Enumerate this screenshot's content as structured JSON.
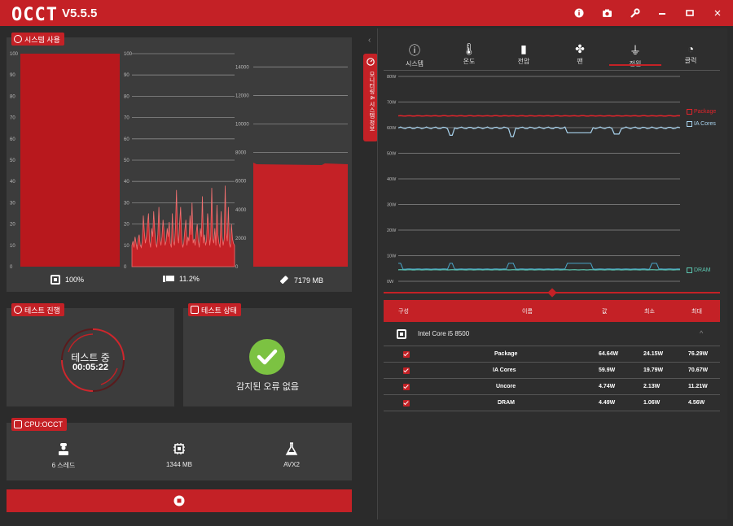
{
  "app": {
    "logo": "OCCT",
    "version": "V5.5.5"
  },
  "titlebar_icons": [
    "info-icon",
    "camera-icon",
    "wrench-icon",
    "minimize-icon",
    "maximize-icon",
    "close-icon"
  ],
  "system_usage": {
    "title": "시스템 사용",
    "cpu_label": "100%",
    "cpu_ticks": [
      "100",
      "90",
      "80",
      "70",
      "60",
      "50",
      "40",
      "30",
      "20",
      "10",
      "0"
    ],
    "cpu_value": 100,
    "load_label": "11.2%",
    "load_ticks": [
      "100",
      "90",
      "80",
      "70",
      "60",
      "50",
      "40",
      "30",
      "20",
      "10",
      "0"
    ],
    "load_series": [
      10,
      12,
      9,
      14,
      11,
      8,
      13,
      15,
      10,
      9,
      12,
      24,
      16,
      11,
      14,
      20,
      25,
      12,
      9,
      18,
      14,
      26,
      17,
      11,
      9,
      15,
      28,
      13,
      10,
      14,
      22,
      16,
      10,
      12,
      18,
      14,
      21,
      11,
      9,
      25,
      12,
      10,
      19,
      36,
      15,
      11,
      20,
      28,
      13,
      9,
      11,
      17,
      22,
      10,
      14,
      12,
      24,
      15,
      30,
      11,
      13,
      10,
      16,
      20,
      12,
      9,
      18,
      14,
      33,
      11,
      15,
      10,
      12,
      25,
      19,
      10,
      14,
      37,
      13,
      11,
      18,
      10,
      29,
      15,
      11,
      9,
      26,
      14,
      10,
      13,
      38,
      16,
      12,
      28,
      11,
      9,
      20,
      13,
      11,
      10
    ],
    "mem_label": "7179 MB",
    "mem_ticks": [
      "14000",
      "12000",
      "10000",
      "8000",
      "6000",
      "4000",
      "2000",
      "0"
    ],
    "mem_value": 7179,
    "mem_max": 15500
  },
  "test_progress": {
    "title": "테스트 진행",
    "status": "테스트 중",
    "time": "00:05:22"
  },
  "test_state": {
    "title": "테스트 상태",
    "message": "감지된 오류 없음"
  },
  "cpu_test": {
    "title": "CPU:OCCT",
    "threads": "6 스레드",
    "memory": "1344 MB",
    "instruction": "AVX2"
  },
  "side_tab": {
    "label": "모니터링 & 시스템 정보"
  },
  "right_tabs": [
    {
      "icon": "info-icon",
      "label": "시스템"
    },
    {
      "icon": "thermometer-icon",
      "label": "온도"
    },
    {
      "icon": "battery-icon",
      "label": "전압"
    },
    {
      "icon": "fan-icon",
      "label": "팬"
    },
    {
      "icon": "plug-icon",
      "label": "전원"
    },
    {
      "icon": "gauge-icon",
      "label": "클럭"
    }
  ],
  "active_tab": "전원",
  "chart_data": {
    "type": "line",
    "y_ticks": [
      "80W",
      "70W",
      "60W",
      "50W",
      "40W",
      "30W",
      "20W",
      "10W",
      "0W"
    ],
    "ylim": [
      0,
      80
    ],
    "series": [
      {
        "name": "Package",
        "color": "#e0242b",
        "level": 64.6
      },
      {
        "name": "IA Cores",
        "color": "#a9d4ef",
        "level": 59.9
      },
      {
        "name": "DRAM",
        "color": "#5cc6b0",
        "level": 4.49
      }
    ]
  },
  "table": {
    "headers": {
      "group": "구성",
      "name": "이름",
      "value": "값",
      "min": "최소",
      "max": "최대"
    },
    "device": "Intel Core i5 8500",
    "rows": [
      {
        "name": "Package",
        "value": "64.64W",
        "min": "24.15W",
        "max": "76.29W"
      },
      {
        "name": "IA Cores",
        "value": "59.9W",
        "min": "19.79W",
        "max": "70.67W"
      },
      {
        "name": "Uncore",
        "value": "4.74W",
        "min": "2.13W",
        "max": "11.21W"
      },
      {
        "name": "DRAM",
        "value": "4.49W",
        "min": "1.06W",
        "max": "4.56W"
      }
    ]
  }
}
